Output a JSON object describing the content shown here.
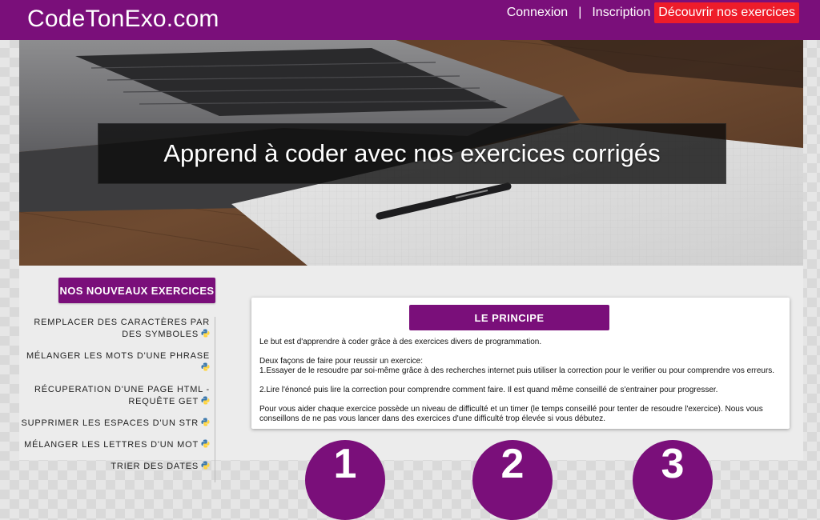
{
  "header": {
    "logo": "CodeTonExo.com",
    "nav": {
      "login": "Connexion",
      "separator": "|",
      "register": "Inscription",
      "discover": "Découvrir nos exercices"
    }
  },
  "hero": {
    "title": "Apprend à coder avec nos exercices corrigés"
  },
  "sidebar": {
    "title": "NOS NOUVEAUX EXERCICES",
    "items": [
      {
        "label": "Remplacer des caractères par des symboles",
        "icon": "python-icon"
      },
      {
        "label": "Mélanger les mots d'une phrase",
        "icon": "python-icon"
      },
      {
        "label": "Récuperation d'une page HTML - requête GET",
        "icon": "python-icon"
      },
      {
        "label": "Supprimer les espaces d'un str",
        "icon": "python-icon"
      },
      {
        "label": "Mélanger les lettres d'un mot",
        "icon": "python-icon"
      },
      {
        "label": "Trier des dates",
        "icon": "python-icon"
      }
    ]
  },
  "principle": {
    "title": "LE PRINCIPE",
    "intro": "Le but est d'apprendre à coder grâce à des exercices divers de programmation.",
    "ways_heading": "Deux façons de faire pour reussir un exercice:",
    "way1": "1.Essayer de le resoudre par soi-même grâce à des recherches internet puis utiliser la correction pour le verifier ou pour comprendre vos erreurs.",
    "way2": "2.Lire l'énoncé puis lire la correction pour comprendre comment faire. Il est quand même conseillé de s'entrainer pour progresser.",
    "help": "Pour vous aider chaque exercice possède un niveau de difficulté et un timer (le temps conseillé pour tenter de resoudre l'exercice). Nous vous conseillons de ne pas vous lancer dans des exercices d'une difficulté trop élevée si vous débutez."
  },
  "steps": [
    "1",
    "2",
    "3"
  ],
  "colors": {
    "brand": "#7a0f7a",
    "accent": "#ee1c2a"
  }
}
